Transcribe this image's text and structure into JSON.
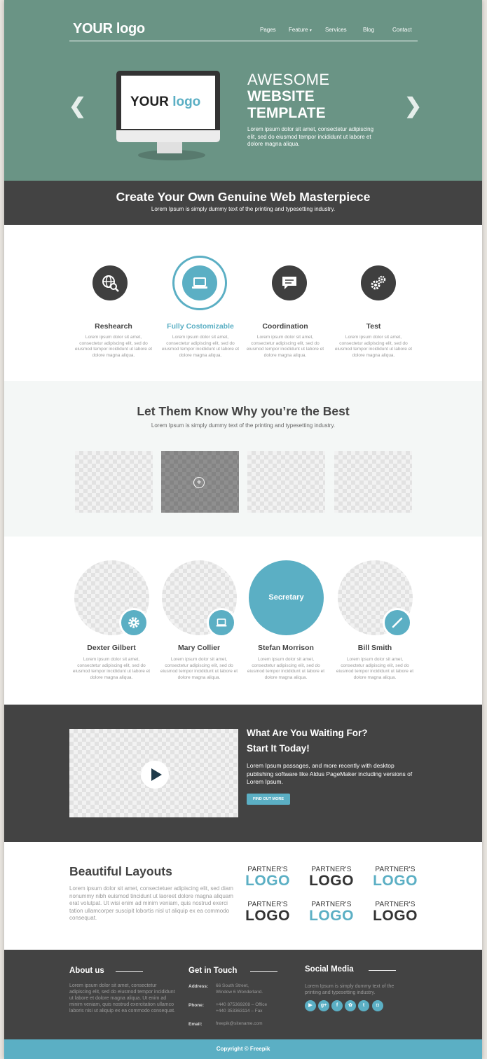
{
  "header": {
    "logo": "YOUR logo",
    "nav": [
      "Pages",
      "Feature",
      "Services",
      "Blog",
      "Contact"
    ]
  },
  "hero": {
    "screen_logo_a": "YOUR",
    "screen_logo_b": "logo",
    "title_1": "AWESOME",
    "title_2": "WEBSITE",
    "title_3": "TEMPLATE",
    "description": "Lorem ipsum dolor sit amet, consectetur adipiscing elit, sed do eiusmod tempor incididunt ut labore et dolore magna aliqua."
  },
  "band": {
    "title": "Create Your Own Genuine Web Masterpiece",
    "subtitle": "Lorem Ipsum is simply dummy text of the printing and typesetting industry."
  },
  "features": [
    {
      "title": "Reshearch",
      "icon": "globe-search-icon",
      "text": "Lorem ipsum dolor sit amet, consectetur adipiscing elit, sed do eiusmod tempor incididunt ut labore et dolore magna aliqua."
    },
    {
      "title": "Fully Costomizable",
      "icon": "laptop-icon",
      "text": "Lorem ipsum dolor sit amet, consectetur adipiscing elit, sed do eiusmod tempor incididunt ut labore et dolore magna aliqua."
    },
    {
      "title": "Coordination",
      "icon": "chat-icon",
      "text": "Lorem ipsum dolor sit amet, consectetur adipiscing elit, sed do eiusmod tempor incididunt ut labore et dolore magna aliqua."
    },
    {
      "title": "Test",
      "icon": "gears-icon",
      "text": "Lorem ipsum dolor sit amet, consectetur adipiscing elit, sed do eiusmod tempor incididunt ut labore et dolore magna aliqua."
    }
  ],
  "why": {
    "title": "Let Them Know Why you’re the Best",
    "subtitle": "Lorem Ipsum is simply dummy text of the printing and typesetting industry."
  },
  "team": [
    {
      "name": "Dexter Gilbert",
      "badge_icon": "gear-icon",
      "text": "Lorem ipsum dolor sit amet, consectetur adipiscing elit, sed do eiusmod tempor incididunt ut labore et dolore magna aliqua."
    },
    {
      "name": "Mary Collier",
      "badge_icon": "laptop-icon",
      "text": "Lorem ipsum dolor sit amet, consectetur adipiscing elit, sed do eiusmod tempor incididunt ut labore et dolore magna aliqua."
    },
    {
      "name": "Stefan Morrison",
      "role": "Secretary",
      "text": "Lorem ipsum dolor sit amet, consectetur adipiscing elit, sed do eiusmod tempor incididunt ut labore et dolore magna aliqua."
    },
    {
      "name": "Bill Smith",
      "badge_icon": "pencil-icon",
      "text": "Lorem ipsum dolor sit amet, consectetur adipiscing elit, sed do eiusmod tempor incididunt ut labore et dolore magna aliqua."
    }
  ],
  "cta": {
    "title_1": "What Are You Waiting For?",
    "title_2": "Start It Today!",
    "description": "Lorem Ipsum passages, and more recently with desktop publishing software like Aldus PageMaker including versions of Lorem Ipsum.",
    "button": "FIND OUT MORE"
  },
  "layouts": {
    "title": "Beautiful Layouts",
    "text": "Lorem ipsum dolor sit amet, consectetuer adipiscing elit, sed diam nonummy nibh euismod tincidunt ut laoreet dolore magna aliquam erat volutpat. Ut wisi enim ad minim veniam, quis nostrud exerci tation ullamcorper suscipit lobortis nisl ut aliquip ex ea commodo consequat.",
    "partner_label": "PARTNER'S",
    "partner_logo": "LOGO"
  },
  "footer": {
    "about_title": "About us",
    "about_text": "Lorem ipsum dolor sit amet, consectetur adipiscing elit, sed do eiusmod tempor incididunt ut labore et dolore magna aliqua. Ut enim ad minim veniam, quis nostrud exercitation ullamco laboris nisi ut aliquip ex ea commodo consequat.",
    "contact_title": "Get in Touch",
    "address_label": "Address:",
    "address_1": "66 South Street,",
    "address_2": "Window 6 Wonderland.",
    "phone_label": "Phone:",
    "phone_1": "+440 875369208 – Office",
    "phone_2": "+440 353363114 – Fax",
    "email_label": "Email:",
    "email": "freepik@sitename.com",
    "social_title": "Social Media",
    "social_text": "Lorem Ipsum is simply dummy text of the printing and typesetting industry.",
    "social_icons": [
      "youtube-icon",
      "google-plus-icon",
      "facebook-icon",
      "dribbble-icon",
      "twitter-icon",
      "instagram-icon"
    ],
    "social_glyphs": [
      "▶",
      "g+",
      "f",
      "✿",
      "t",
      "◘"
    ],
    "copyright": "Copyright © Freepik"
  },
  "colors": {
    "teal": "#6a9485",
    "dark": "#434343",
    "accent": "#5bafc4"
  }
}
